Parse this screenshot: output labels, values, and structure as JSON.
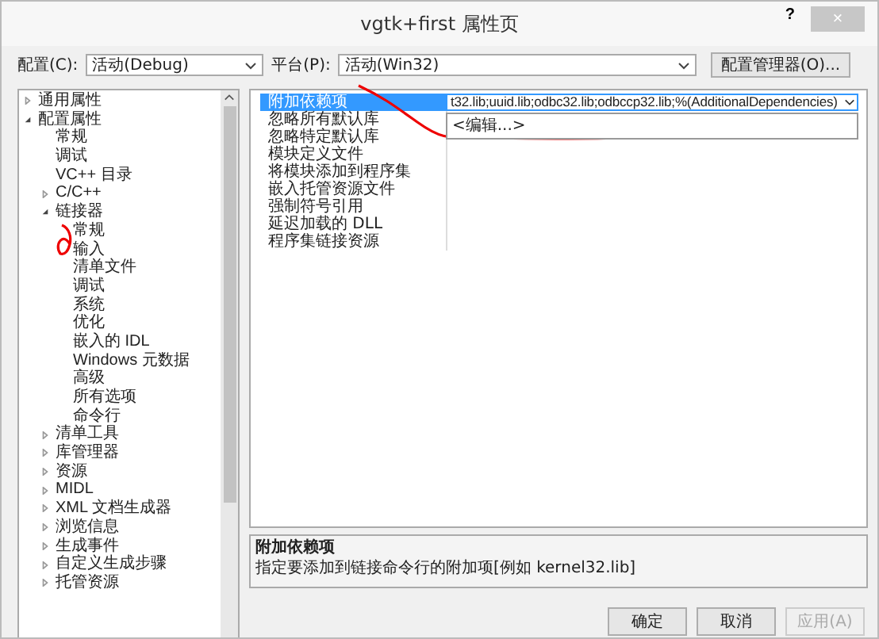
{
  "window": {
    "title": "vgtk+first 属性页",
    "help": "?",
    "close": "×"
  },
  "toolbar": {
    "config_label": "配置(C):",
    "config_value": "活动(Debug)",
    "platform_label": "平台(P):",
    "platform_value": "活动(Win32)",
    "manager_button": "配置管理器(O)..."
  },
  "tree": [
    {
      "label": "通用属性",
      "expanded": false
    },
    {
      "label": "配置属性",
      "expanded": true,
      "children": [
        {
          "label": "常规"
        },
        {
          "label": "调试"
        },
        {
          "label": "VC++ 目录"
        },
        {
          "label": "C/C++",
          "expanded": false
        },
        {
          "label": "链接器",
          "expanded": true,
          "children": [
            {
              "label": "常规"
            },
            {
              "label": "输入"
            },
            {
              "label": "清单文件"
            },
            {
              "label": "调试"
            },
            {
              "label": "系统"
            },
            {
              "label": "优化"
            },
            {
              "label": "嵌入的 IDL"
            },
            {
              "label": "Windows 元数据"
            },
            {
              "label": "高级"
            },
            {
              "label": "所有选项"
            },
            {
              "label": "命令行"
            }
          ]
        },
        {
          "label": "清单工具",
          "expanded": false
        },
        {
          "label": "库管理器",
          "expanded": false
        },
        {
          "label": "资源",
          "expanded": false
        },
        {
          "label": "MIDL",
          "expanded": false
        },
        {
          "label": "XML 文档生成器",
          "expanded": false
        },
        {
          "label": "浏览信息",
          "expanded": false
        },
        {
          "label": "生成事件",
          "expanded": false
        },
        {
          "label": "自定义生成步骤",
          "expanded": false
        },
        {
          "label": "托管资源",
          "expanded": false
        }
      ]
    }
  ],
  "properties": [
    {
      "name": "附加依赖项",
      "value": "t32.lib;uuid.lib;odbc32.lib;odbccp32.lib;%(AdditionalDependencies)",
      "selected": true,
      "dropdown": [
        "<编辑...>"
      ]
    },
    {
      "name": "忽略所有默认库",
      "selected": false
    },
    {
      "name": "忽略特定默认库",
      "selected": false
    },
    {
      "name": "模块定义文件",
      "selected": false
    },
    {
      "name": "将模块添加到程序集",
      "selected": false
    },
    {
      "name": "嵌入托管资源文件",
      "selected": false
    },
    {
      "name": "强制符号引用",
      "selected": false
    },
    {
      "name": "延迟加载的 DLL",
      "selected": false
    },
    {
      "name": "程序集链接资源",
      "selected": false
    }
  ],
  "description": {
    "title": "附加依赖项",
    "text": "指定要添加到链接命令行的附加项[例如 kernel32.lib]"
  },
  "buttons": [
    {
      "label": "确定",
      "disabled": false
    },
    {
      "label": "取消",
      "disabled": false
    },
    {
      "label": "应用(A)",
      "disabled": true
    }
  ]
}
